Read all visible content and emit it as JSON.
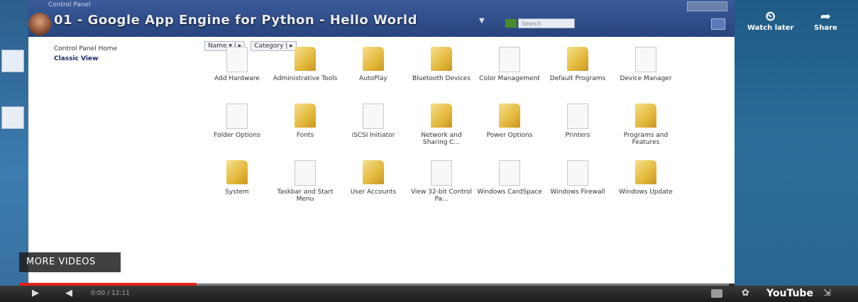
{
  "window": {
    "control_panel_title": "Control Panel",
    "video_title": "01 - Google App Engine for Python - Hello World",
    "search_placeholder": "Search"
  },
  "sidebar": {
    "home": "Control Panel Home",
    "classic": "Classic View"
  },
  "columns": [
    "Name",
    "Category"
  ],
  "items": [
    {
      "label": "Add Hardware",
      "icon": "document-icon"
    },
    {
      "label": "Administrative Tools",
      "icon": "folder-icon"
    },
    {
      "label": "AutoPlay",
      "icon": "folder-icon"
    },
    {
      "label": "Bluetooth Devices",
      "icon": "folder-icon"
    },
    {
      "label": "Color Management",
      "icon": "document-icon"
    },
    {
      "label": "Default Programs",
      "icon": "folder-icon"
    },
    {
      "label": "Device Manager",
      "icon": "document-icon"
    },
    {
      "label": "Folder Options",
      "icon": "document-icon"
    },
    {
      "label": "Fonts",
      "icon": "folder-icon"
    },
    {
      "label": "iSCSI Initiator",
      "icon": "document-icon"
    },
    {
      "label": "Network and Sharing C...",
      "icon": "folder-icon"
    },
    {
      "label": "Power Options",
      "icon": "folder-icon"
    },
    {
      "label": "Printers",
      "icon": "document-icon"
    },
    {
      "label": "Programs and Features",
      "icon": "folder-icon"
    },
    {
      "label": "System",
      "icon": "folder-icon"
    },
    {
      "label": "Taskbar and Start Menu",
      "icon": "document-icon"
    },
    {
      "label": "User Accounts",
      "icon": "folder-icon"
    },
    {
      "label": "View 32-bit Control Pa...",
      "icon": "document-icon"
    },
    {
      "label": "Windows CardSpace",
      "icon": "document-icon"
    },
    {
      "label": "Windows Firewall",
      "icon": "document-icon"
    },
    {
      "label": "Windows Update",
      "icon": "folder-icon"
    }
  ],
  "youtube": {
    "watch_later": "Watch later",
    "share": "Share",
    "more_videos": "MORE VIDEOS",
    "time": "0:00 / 12:11",
    "logo": "YouTube",
    "progress": 0.25
  }
}
